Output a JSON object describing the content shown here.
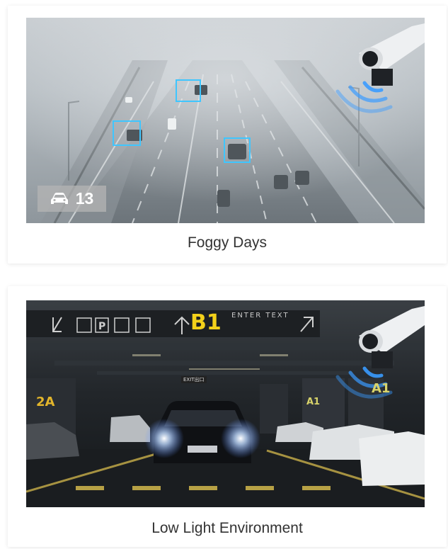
{
  "cards": [
    {
      "caption": "Foggy Days",
      "vehicle_count": "13",
      "icons": [
        "car-icon",
        "camera-icon",
        "wifi-signal-icon"
      ]
    },
    {
      "caption": "Low Light Environment",
      "signage": {
        "level": "B1",
        "enter_text": "ENTER TEXT",
        "exit_text": "EXIT出口",
        "zone_a1": "A1",
        "zone_2a": "2A"
      },
      "icons": [
        "camera-icon",
        "wifi-signal-icon",
        "parking-icon",
        "elevator-icon",
        "stairs-icon"
      ]
    }
  ],
  "colors": {
    "detect_box": "#3fc6ff",
    "signal": "#3a9bff",
    "level_sign": "#f4d11a"
  }
}
